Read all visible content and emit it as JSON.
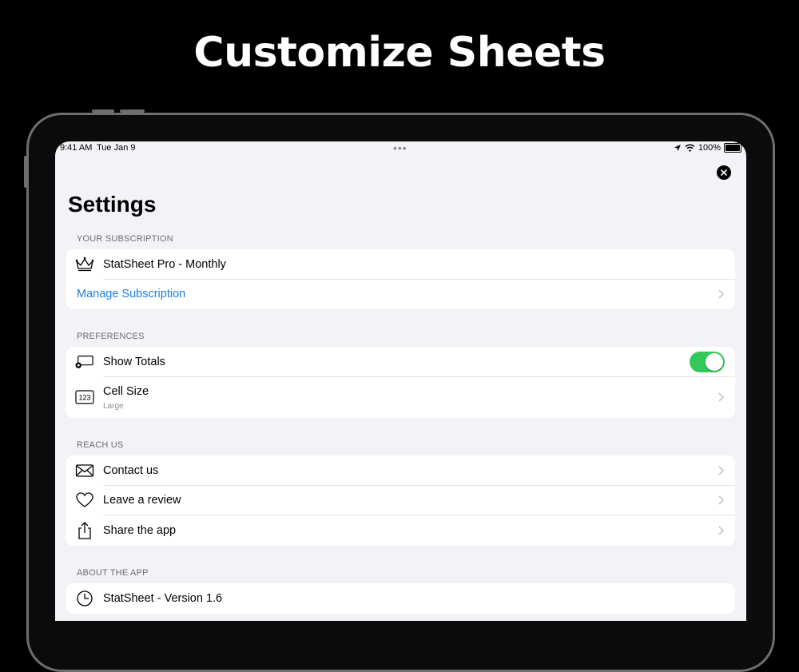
{
  "headline": "Customize Sheets",
  "status_bar": {
    "time": "9:41 AM",
    "date": "Tue Jan 9",
    "battery": "100%"
  },
  "title": "Settings",
  "sections": {
    "subscription": {
      "header": "YOUR SUBSCRIPTION",
      "plan": "StatSheet Pro - Monthly",
      "manage": "Manage Subscription"
    },
    "preferences": {
      "header": "PREFERENCES",
      "show_totals": {
        "label": "Show Totals",
        "enabled": true
      },
      "cell_size": {
        "label": "Cell Size",
        "value": "Large"
      }
    },
    "reach_us": {
      "header": "REACH US",
      "contact": "Contact us",
      "review": "Leave a review",
      "share": "Share the app"
    },
    "about": {
      "header": "ABOUT THE APP",
      "version": "StatSheet - Version 1.6"
    }
  },
  "colors": {
    "link": "#1a7fe0",
    "toggle_on": "#34c759",
    "background": "#f2f2f7"
  }
}
